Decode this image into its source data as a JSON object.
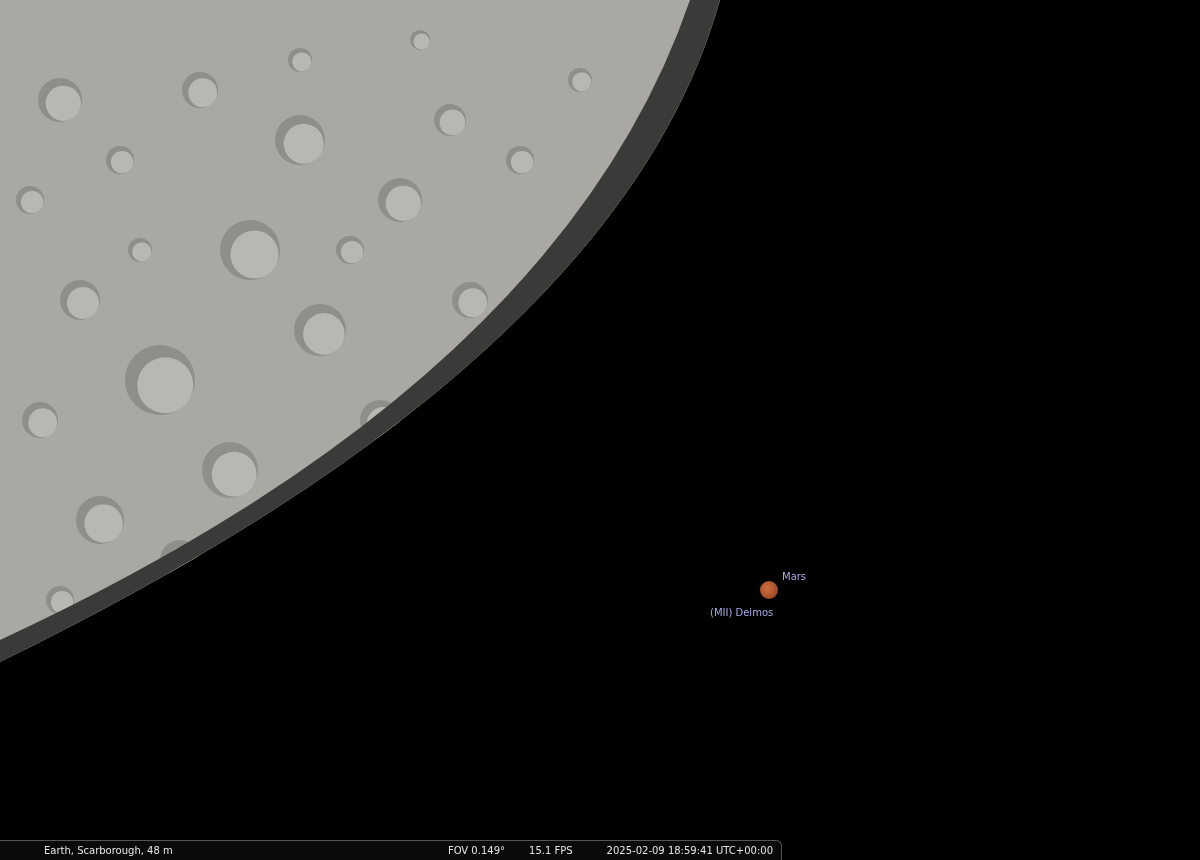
{
  "sky": {
    "objects": [
      {
        "kind": "planet",
        "label": "Mars"
      },
      {
        "kind": "moon",
        "label": "(MII) Deimos"
      }
    ]
  },
  "status_bar": {
    "location": "Earth, Scarborough, 48 m",
    "fov": "FOV 0.149°",
    "fps": "15.1 FPS",
    "datetime": "2025-02-09 18:59:41 UTC+00:00"
  }
}
